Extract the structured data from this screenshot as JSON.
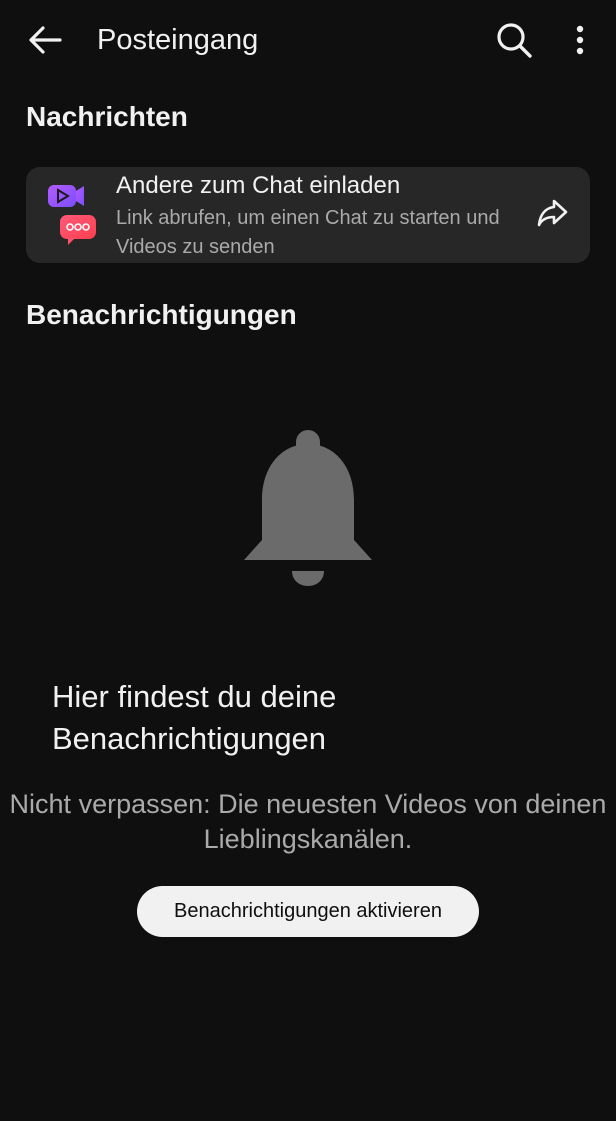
{
  "header": {
    "back_icon": "arrow-left-icon",
    "title": "Posteingang",
    "search_icon": "search-icon",
    "more_icon": "more-vertical-icon"
  },
  "messages": {
    "heading": "Nachrichten",
    "invite": {
      "icon": "chat-invite-icon",
      "title": "Andere zum Chat einladen",
      "subtitle": "Link abrufen, um einen Chat zu starten und Videos zu senden",
      "share_icon": "share-icon"
    }
  },
  "notifications": {
    "heading": "Benachrichtigungen",
    "empty_icon": "bell-icon",
    "empty_title": "Hier findest du deine Benachrichtigungen",
    "empty_subtitle": "Nicht verpassen: Die neuesten Videos von deinen Lieblingskanälen.",
    "enable_button": "Benachrichtigungen aktivieren"
  },
  "colors": {
    "background": "#0f0f0f",
    "card": "#272727",
    "text_primary": "#f1f1f1",
    "text_secondary": "#aaaaaa",
    "icon_purple": "#a259ff",
    "icon_red": "#ff4e6a",
    "bell": "#6b6b6b"
  }
}
